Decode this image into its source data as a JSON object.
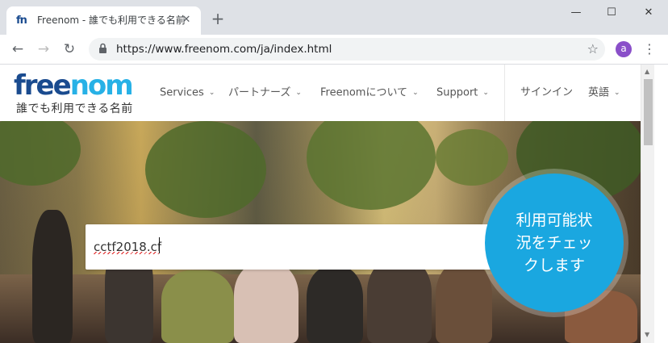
{
  "browser": {
    "tab": {
      "title": "Freenom - 誰でも利用できる名前",
      "favicon": "fn",
      "close": "✕"
    },
    "new_tab": "+",
    "window_controls": {
      "minimize": "—",
      "maximize": "☐",
      "close": "✕"
    },
    "nav": {
      "back": "←",
      "forward": "→",
      "reload": "↻"
    },
    "url": "https://www.freenom.com/ja/index.html",
    "bookmark_star": "☆",
    "profile_initial": "a",
    "menu": "⋮"
  },
  "site": {
    "logo": {
      "part1": "free",
      "part2": "nom"
    },
    "tagline": "誰でも利用できる名前",
    "nav": [
      {
        "label": "Services"
      },
      {
        "label": "パートナーズ"
      },
      {
        "label": "Freenomについて"
      },
      {
        "label": "Support"
      }
    ],
    "signin": "サインイン",
    "language": "英語",
    "chevron": "⌄"
  },
  "search": {
    "value": "cctf2018.cf",
    "button_lines": [
      "利用可能状",
      "況をチェッ",
      "クします"
    ]
  },
  "scrollbar": {
    "up": "▲",
    "down": "▼"
  }
}
